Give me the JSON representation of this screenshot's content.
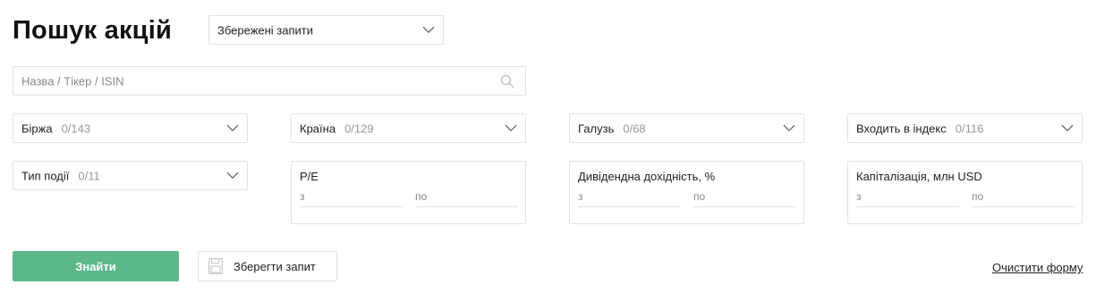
{
  "page": {
    "title": "Пошук акцій"
  },
  "saved_queries": {
    "label": "Збережені запити"
  },
  "search": {
    "placeholder": "Назва / Тікер / ISIN"
  },
  "filters": {
    "exchange": {
      "label": "Біржа",
      "count": "0/143"
    },
    "country": {
      "label": "Країна",
      "count": "0/129"
    },
    "industry": {
      "label": "Галузь",
      "count": "0/68"
    },
    "index": {
      "label": "Входить в індекс",
      "count": "0/116"
    },
    "event_type": {
      "label": "Тип події",
      "count": "0/11"
    }
  },
  "ranges": {
    "pe": {
      "label": "P/E",
      "from": "з",
      "to": "по"
    },
    "dividend": {
      "label": "Дивідендна дохідність, %",
      "from": "з",
      "to": "по"
    },
    "cap": {
      "label": "Капіталізація, млн USD",
      "from": "з",
      "to": "по"
    }
  },
  "actions": {
    "find": "Знайти",
    "save": "Зберегти запит",
    "clear": "Очистити форму"
  },
  "icons": {
    "search": "search-icon",
    "chevron": "chevron-down-icon",
    "floppy": "floppy-disk-icon"
  },
  "colors": {
    "accent": "#5cb88a",
    "border": "#e3e3e3",
    "muted": "#999999"
  }
}
